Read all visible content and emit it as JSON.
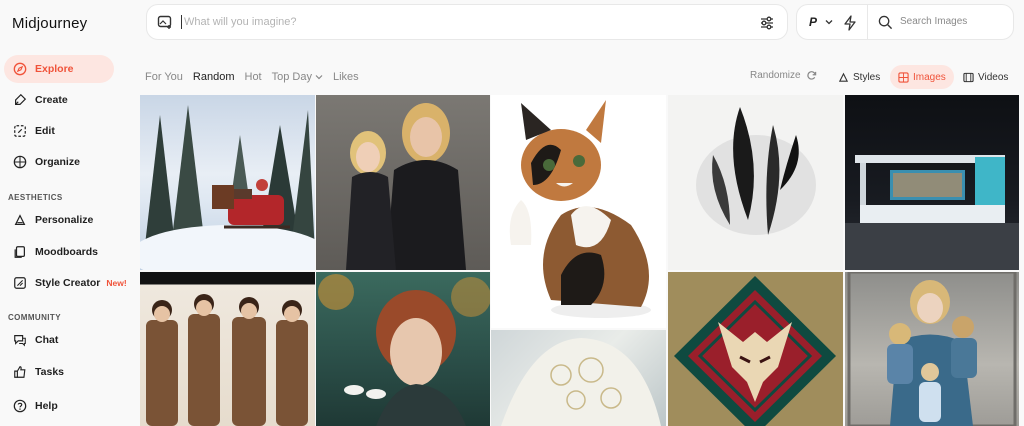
{
  "app": {
    "title": "Midjourney"
  },
  "sidebar": {
    "items": [
      {
        "label": "Explore",
        "icon": "compass-icon",
        "active": true
      },
      {
        "label": "Create",
        "icon": "paintbrush-icon"
      },
      {
        "label": "Edit",
        "icon": "edit-icon"
      },
      {
        "label": "Organize",
        "icon": "grid-icon"
      }
    ],
    "aesthetics_label": "AESTHETICS",
    "aesthetics_items": [
      {
        "label": "Personalize",
        "icon": "personalize-icon"
      },
      {
        "label": "Moodboards",
        "icon": "moodboard-icon"
      },
      {
        "label": "Style Creator",
        "icon": "style-creator-icon",
        "badge": "New!"
      }
    ],
    "community_label": "COMMUNITY",
    "community_items": [
      {
        "label": "Chat",
        "icon": "chat-icon"
      },
      {
        "label": "Tasks",
        "icon": "thumbs-up-icon"
      },
      {
        "label": "Help",
        "icon": "help-icon"
      }
    ]
  },
  "prompt": {
    "placeholder": "What will you imagine?"
  },
  "search": {
    "placeholder": "Search Images",
    "p_label": "P"
  },
  "filters": {
    "items": [
      "For You",
      "Random",
      "Hot",
      "Top Day",
      "Likes"
    ],
    "active": "Random"
  },
  "randomize_label": "Randomize",
  "tabs": [
    {
      "label": "Styles",
      "icon": "styles-icon"
    },
    {
      "label": "Images",
      "icon": "images-icon",
      "active": true
    },
    {
      "label": "Videos",
      "icon": "videos-icon"
    }
  ],
  "colors": {
    "accent": "#f0533a",
    "accent_bg": "#fde6e1"
  },
  "gallery": [
    "winter sleigh painting",
    "mother and daughter portrait",
    "calico cat waving",
    "ink feathers",
    "exhibition booth",
    "group of men in suits",
    "red-haired woman with swans",
    "white lace detail",
    "dragon emblem",
    "mother with children painting"
  ]
}
